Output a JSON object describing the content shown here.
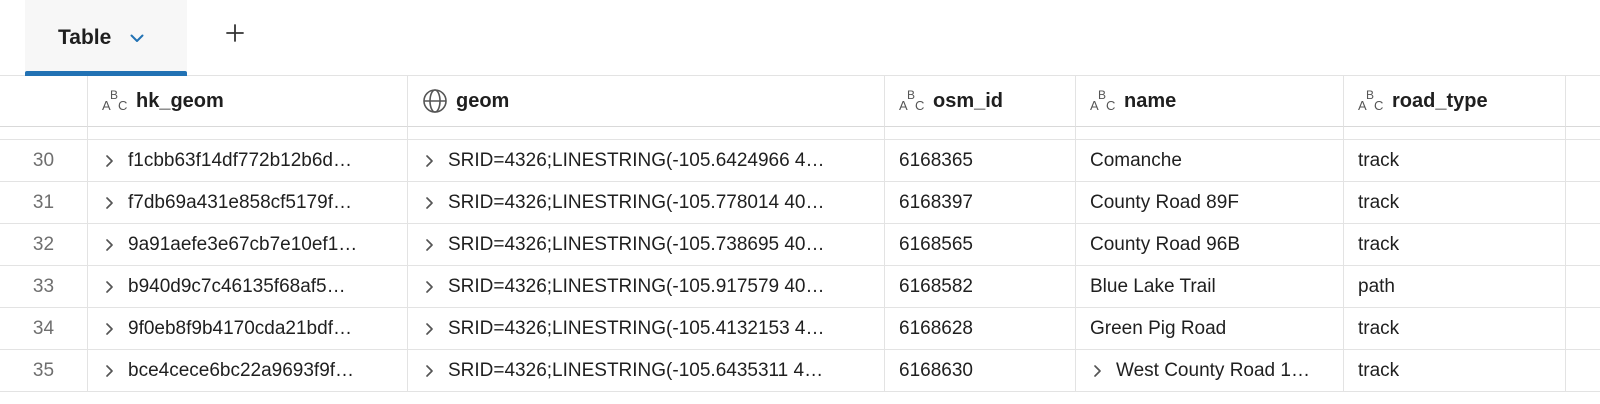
{
  "tabs": [
    {
      "label": "Table",
      "active": true
    }
  ],
  "add_tab_label": "+",
  "accent_color": "#2272b4",
  "columns": [
    {
      "key": "hk_geom",
      "label": "hk_geom",
      "type_icon": "string-type-icon"
    },
    {
      "key": "geom",
      "label": "geom",
      "type_icon": "globe-icon"
    },
    {
      "key": "osm_id",
      "label": "osm_id",
      "type_icon": "string-type-icon"
    },
    {
      "key": "name",
      "label": "name",
      "type_icon": "string-type-icon"
    },
    {
      "key": "road_type",
      "label": "road_type",
      "type_icon": "string-type-icon"
    }
  ],
  "rows": [
    {
      "index": "30",
      "hk_geom": "f1cbb63f14df772b12b6d…",
      "geom": "SRID=4326;LINESTRING(-105.6424966 4…",
      "osm_id": "6168365",
      "name": "Comanche",
      "name_expandable": false,
      "road_type": "track"
    },
    {
      "index": "31",
      "hk_geom": "f7db69a431e858cf5179f…",
      "geom": "SRID=4326;LINESTRING(-105.778014 40…",
      "osm_id": "6168397",
      "name": "County Road 89F",
      "name_expandable": false,
      "road_type": "track"
    },
    {
      "index": "32",
      "hk_geom": "9a91aefe3e67cb7e10ef1…",
      "geom": "SRID=4326;LINESTRING(-105.738695 40…",
      "osm_id": "6168565",
      "name": "County Road 96B",
      "name_expandable": false,
      "road_type": "track"
    },
    {
      "index": "33",
      "hk_geom": "b940d9c7c46135f68af5…",
      "geom": "SRID=4326;LINESTRING(-105.917579 40…",
      "osm_id": "6168582",
      "name": "Blue Lake Trail",
      "name_expandable": false,
      "road_type": "path"
    },
    {
      "index": "34",
      "hk_geom": "9f0eb8f9b4170cda21bdf…",
      "geom": "SRID=4326;LINESTRING(-105.4132153 4…",
      "osm_id": "6168628",
      "name": "Green Pig Road",
      "name_expandable": false,
      "road_type": "track"
    },
    {
      "index": "35",
      "hk_geom": "bce4cece6bc22a9693f9f…",
      "geom": "SRID=4326;LINESTRING(-105.6435311 4…",
      "osm_id": "6168630",
      "name": "West County Road 1…",
      "name_expandable": true,
      "road_type": "track"
    }
  ]
}
